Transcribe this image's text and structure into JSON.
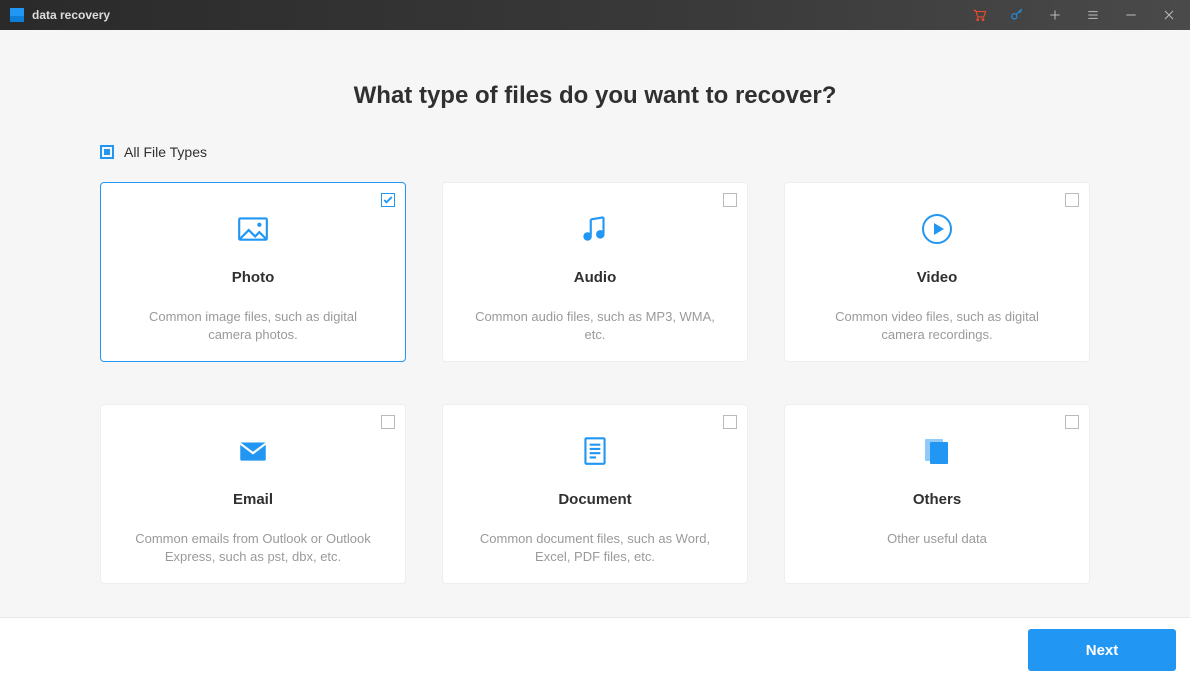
{
  "titlebar": {
    "app_name": "data recovery"
  },
  "heading": "What type of files do you want to recover?",
  "all_types_label": "All File Types",
  "cards": [
    {
      "title": "Photo",
      "desc": "Common image files, such as digital camera photos.",
      "selected": true
    },
    {
      "title": "Audio",
      "desc": "Common audio files, such as MP3, WMA, etc.",
      "selected": false
    },
    {
      "title": "Video",
      "desc": "Common video files, such as digital camera recordings.",
      "selected": false
    },
    {
      "title": "Email",
      "desc": "Common emails from Outlook or Outlook Express, such as pst, dbx, etc.",
      "selected": false
    },
    {
      "title": "Document",
      "desc": "Common document files, such as Word, Excel, PDF files, etc.",
      "selected": false
    },
    {
      "title": "Others",
      "desc": "Other useful data",
      "selected": false
    }
  ],
  "footer": {
    "next_label": "Next"
  },
  "colors": {
    "accent": "#2196f3"
  }
}
